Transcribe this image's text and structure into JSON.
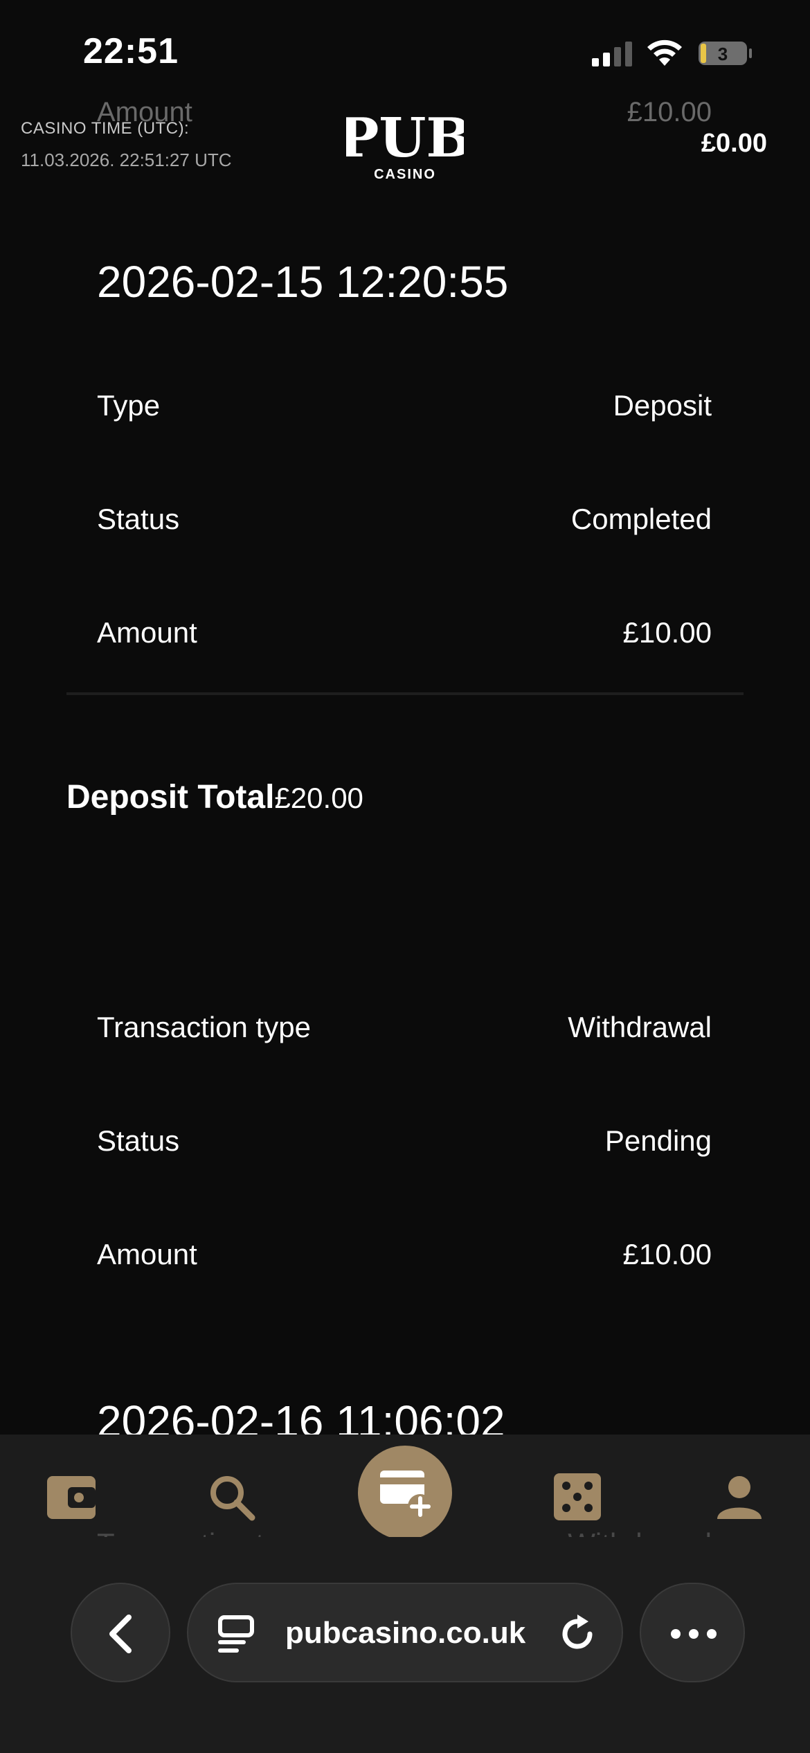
{
  "status_bar": {
    "time": "22:51",
    "battery_level": "3"
  },
  "header": {
    "casino_time_label": "CASINO TIME (UTC):",
    "casino_time_value": "11.03.2026. 22:51:27 UTC",
    "logo_text": "PUB",
    "logo_subtext": "CASINO",
    "balance": "£0.00"
  },
  "ghost_row": {
    "label": "Amount",
    "value": "£10.00"
  },
  "transactions": [
    {
      "date": "2026-02-15 12:20:55",
      "rows": [
        {
          "label": "Type",
          "value": "Deposit"
        },
        {
          "label": "Status",
          "value": "Completed"
        },
        {
          "label": "Amount",
          "value": "£10.00"
        }
      ]
    }
  ],
  "deposit_total": {
    "label": "Deposit Total",
    "amount": "£20.00"
  },
  "withdrawal": {
    "rows": [
      {
        "label": "Transaction type",
        "value": "Withdrawal"
      },
      {
        "label": "Status",
        "value": "Pending"
      },
      {
        "label": "Amount",
        "value": "£10.00"
      }
    ],
    "next_date": "2026-02-16 11:06:02",
    "next_row": {
      "label": "Transaction type",
      "value": "Withdrawal"
    }
  },
  "bottom_nav": {
    "items": [
      "wallet-icon",
      "search-icon",
      "deposit-card-icon",
      "dice-icon",
      "profile-icon"
    ],
    "accent_color": "#a08865"
  },
  "browser": {
    "url": "pubcasino.co.uk"
  }
}
